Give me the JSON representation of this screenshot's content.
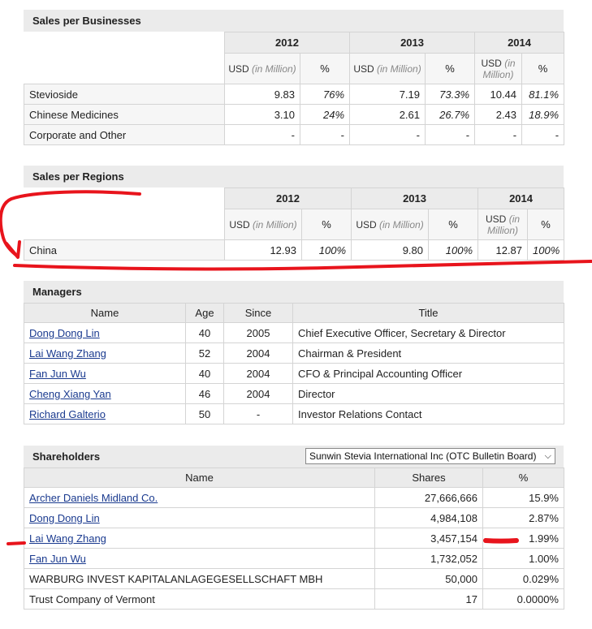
{
  "business": {
    "title": "Sales per Businesses",
    "years": [
      "2012",
      "2013",
      "2014"
    ],
    "usd_prefix": "USD",
    "usd_suffix": "(in Million)",
    "usd_prefix_short": "USD",
    "usd_suffix_a": "(in",
    "usd_suffix_b": "Million)",
    "pct_label": "%",
    "rows": [
      {
        "name": "Stevioside",
        "v2012": "9.83",
        "p2012": "76%",
        "v2013": "7.19",
        "p2013": "73.3%",
        "v2014": "10.44",
        "p2014": "81.1%"
      },
      {
        "name": "Chinese Medicines",
        "v2012": "3.10",
        "p2012": "24%",
        "v2013": "2.61",
        "p2013": "26.7%",
        "v2014": "2.43",
        "p2014": "18.9%"
      },
      {
        "name": "Corporate and Other",
        "v2012": "-",
        "p2012": "-",
        "v2013": "-",
        "p2013": "-",
        "v2014": "-",
        "p2014": "-"
      }
    ]
  },
  "regions": {
    "title": "Sales per Regions",
    "years": [
      "2012",
      "2013",
      "2014"
    ],
    "rows": [
      {
        "name": "China",
        "v2012": "12.93",
        "p2012": "100%",
        "v2013": "9.80",
        "p2013": "100%",
        "v2014": "12.87",
        "p2014": "100%"
      }
    ]
  },
  "managers": {
    "title": "Managers",
    "headers": {
      "name": "Name",
      "age": "Age",
      "since": "Since",
      "title": "Title"
    },
    "rows": [
      {
        "name": "Dong Dong Lin",
        "age": "40",
        "since": "2005",
        "title": "Chief Executive Officer, Secretary & Director"
      },
      {
        "name": "Lai Wang Zhang",
        "age": "52",
        "since": "2004",
        "title": "Chairman & President"
      },
      {
        "name": "Fan Jun Wu",
        "age": "40",
        "since": "2004",
        "title": "CFO & Principal Accounting Officer"
      },
      {
        "name": "Cheng Xiang Yan",
        "age": "46",
        "since": "2004",
        "title": "Director"
      },
      {
        "name": "Richard Galterio",
        "age": "50",
        "since": "-",
        "title": "Investor Relations Contact"
      }
    ]
  },
  "shareholders": {
    "title": "Shareholders",
    "select_value": "Sunwin Stevia International Inc (OTC Bulletin Board)",
    "headers": {
      "name": "Name",
      "shares": "Shares",
      "pct": "%"
    },
    "rows": [
      {
        "name": "Archer Daniels Midland Co.",
        "shares": "27,666,666",
        "pct": "15.9%",
        "link": true
      },
      {
        "name": "Dong Dong Lin",
        "shares": "4,984,108",
        "pct": "2.87%",
        "link": true
      },
      {
        "name": "Lai Wang Zhang",
        "shares": "3,457,154",
        "pct": "1.99%",
        "link": true
      },
      {
        "name": "Fan Jun Wu",
        "shares": "1,732,052",
        "pct": "1.00%",
        "link": true
      },
      {
        "name": "WARBURG INVEST KAPITALANLAGEGESELLSCHAFT MBH",
        "shares": "50,000",
        "pct": "0.029%",
        "link": false
      },
      {
        "name": "Trust Company of Vermont",
        "shares": "17",
        "pct": "0.0000%",
        "link": false
      }
    ]
  },
  "colors": {
    "annotation": "#e8141c",
    "link": "#1a3a8f",
    "header_bg": "#ebebeb"
  }
}
